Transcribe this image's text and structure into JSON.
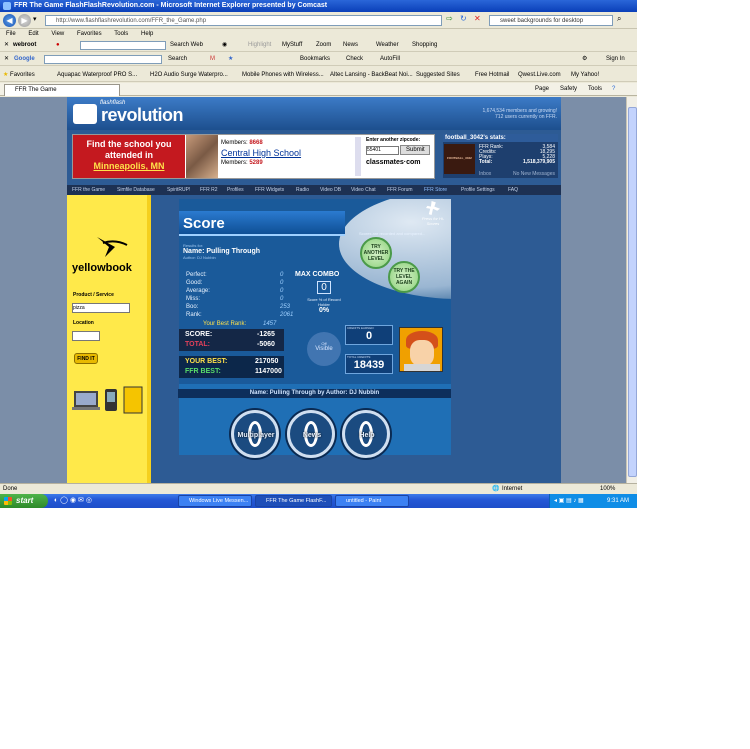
{
  "window": {
    "title": "FFR The Game FlashFlashRevolution.com - Microsoft Internet Explorer presented by Comcast"
  },
  "address": {
    "url": "http://www.flashflashrevolution.com/FFR_the_Game.php",
    "search": "sweet backgrounds for desktop"
  },
  "menu": [
    "File",
    "Edit",
    "View",
    "Favorites",
    "Tools",
    "Help"
  ],
  "toolbar1": {
    "brand": "webroot",
    "items": [
      "Search Web",
      "Highlight",
      "MyStuff",
      "Zoom",
      "News",
      "Weather",
      "Shopping"
    ]
  },
  "toolbar2": {
    "brand": "Google",
    "items": [
      "Search",
      "Bookmarks",
      "Check",
      "AutoFill"
    ],
    "signin": "Sign In"
  },
  "favorites": {
    "label": "Favorites",
    "items": [
      "Aquapac Waterproof PRO S...",
      "H2O Audio Surge Waterpro...",
      "Mobile Phones with Wireless...",
      "Altec Lansing - BackBeat Noi...",
      "Suggested Sites",
      "Free Hotmail",
      "Qwest.Live.com",
      "My Yahoo!"
    ]
  },
  "tab": {
    "label": "FFR The Game FlashFlashRevolution.com",
    "tools": [
      "Page",
      "Safety",
      "Tools"
    ]
  },
  "site": {
    "logo_small": "flashflash",
    "logo_big": "revolution",
    "members_line1": "1,674,534 members and growing!",
    "members_line2": "712 users currently on FFR.",
    "nav": [
      "FFR the Game",
      "Simfile Database",
      "SpiritRUP!",
      "FFR R2",
      "Profiles",
      "FFR Widgets",
      "Radio",
      "Video DB",
      "Video Chat",
      "FFR Forum",
      "FFR Store",
      "Profile Settings",
      "FAQ"
    ]
  },
  "ad": {
    "line1": "Find the school you",
    "line2": "attended in",
    "city": "Minneapolis, MN",
    "members_label": "Members:",
    "members1": "8668",
    "school": "Central High School",
    "members2": "5289",
    "zip_label": "Enter another zipcode:",
    "zip_value": "55401",
    "submit": "Submit",
    "brand": "classmates·com"
  },
  "user_stats": {
    "header": "football_3042's stats:",
    "avatar_text": "FOOTBALL_3042",
    "rows": [
      {
        "label": "FFR Rank:",
        "value": "3,584"
      },
      {
        "label": "Credits:",
        "value": "18,295"
      },
      {
        "label": "Plays:",
        "value": "5,228"
      },
      {
        "label": "Total:",
        "value": "1,518,379,905"
      }
    ],
    "footer_left": "Inbox",
    "footer_right": "No New Messages"
  },
  "yellowbook": {
    "brand": "yellowbook",
    "product_label": "Product / Service",
    "product_value": "pizza",
    "location_label": "Location",
    "find": "FIND IT"
  },
  "game": {
    "score_title": "Score",
    "press_label": "Press for Hi-Scores",
    "recorded_note": "Scores are recorded and compared...",
    "try_another": "TRY ANOTHER LEVEL",
    "try_level": "TRY THE LEVEL AGAIN",
    "results_for": "Results for:",
    "name": "Name: Pulling Through",
    "author": "Author: DJ Nubbin",
    "stats": [
      {
        "label": "Perfect:",
        "value": "0"
      },
      {
        "label": "Good:",
        "value": "0"
      },
      {
        "label": "Average:",
        "value": "0"
      },
      {
        "label": "Miss:",
        "value": "0"
      },
      {
        "label": "Boo:",
        "value": "253"
      },
      {
        "label": "Rank:",
        "value": "2061"
      }
    ],
    "your_best_rank": "Your Best Rank:",
    "your_best_rank_value": "1457",
    "max_combo": "MAX COMBO",
    "max_combo_value": "0",
    "score_pct_label": "Score % of Record Holder",
    "score_pct": "0%",
    "score_label": "SCORE:",
    "score_value": "-1265",
    "total_label": "TOTAL:",
    "total_value": "-5060",
    "your_best_label": "YOUR BEST:",
    "your_best_value": "217050",
    "ffr_best_label": "FFR BEST:",
    "ffr_best_value": "1147000",
    "toggle_off": "Off",
    "toggle_visible": "Visible",
    "credits_earned_label": "CREDITS EARNED:",
    "credits_earned_value": "0",
    "total_credits_label": "TOTAL CREDITS:",
    "total_credits_value": "18439",
    "song_line": "Name: Pulling Through by Author: DJ Nubbin",
    "buttons": [
      "Multiplayer",
      "News",
      "Help"
    ]
  },
  "status": {
    "left": "Done",
    "zone": "Internet",
    "zoom": "100%"
  },
  "taskbar": {
    "start": "start",
    "tasks": [
      "Windows Live Messen...",
      "FFR The Game FlashF...",
      "untitled - Paint"
    ],
    "clock": "9:31 AM"
  }
}
